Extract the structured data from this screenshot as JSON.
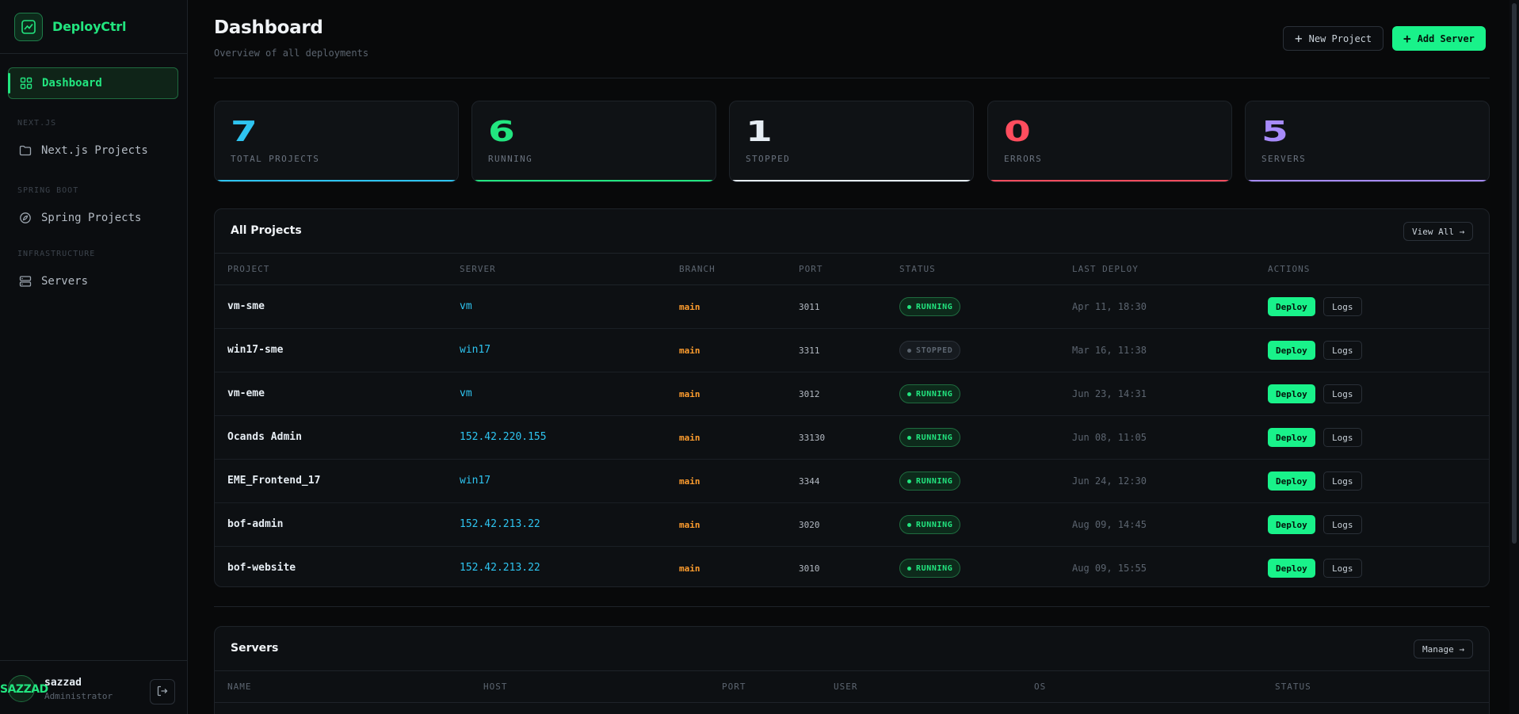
{
  "app": {
    "name": "DeployCtrl"
  },
  "sidebar": {
    "items": [
      {
        "label": "Dashboard",
        "icon": "grid-icon"
      },
      {
        "section": "NEXT.JS",
        "label": "Next.js Projects",
        "icon": "folder-icon"
      },
      {
        "section": "SPRING BOOT",
        "label": "Spring Projects",
        "icon": "spring-icon"
      },
      {
        "section": "INFRASTRUCTURE",
        "label": "Servers",
        "icon": "server-icon"
      }
    ],
    "user": {
      "avatar_text": "SAZZAD",
      "name": "sazzad",
      "role": "Administrator"
    }
  },
  "header": {
    "title": "Dashboard",
    "subtitle": "Overview of all deployments",
    "new_project": "New Project",
    "add_server": "Add Server"
  },
  "stats": [
    {
      "value": "7",
      "label": "TOTAL PROJECTS",
      "color": "#2ec4f0"
    },
    {
      "value": "6",
      "label": "RUNNING",
      "color": "#22e57f"
    },
    {
      "value": "1",
      "label": "STOPPED",
      "color": "#e6edf3"
    },
    {
      "value": "0",
      "label": "ERRORS",
      "color": "#ff4d5e"
    },
    {
      "value": "5",
      "label": "SERVERS",
      "color": "#a78bfa"
    }
  ],
  "projects": {
    "title": "All Projects",
    "view_all": "View All →",
    "columns": [
      "PROJECT",
      "SERVER",
      "BRANCH",
      "PORT",
      "STATUS",
      "LAST DEPLOY",
      "ACTIONS"
    ],
    "deploy_label": "Deploy",
    "logs_label": "Logs",
    "rows": [
      {
        "project": "vm-sme",
        "server": "vm",
        "branch": "main",
        "port": "3011",
        "status": "RUNNING",
        "last_deploy": "Apr 11, 18:30"
      },
      {
        "project": "win17-sme",
        "server": "win17",
        "branch": "main",
        "port": "3311",
        "status": "STOPPED",
        "last_deploy": "Mar 16, 11:38"
      },
      {
        "project": "vm-eme",
        "server": "vm",
        "branch": "main",
        "port": "3012",
        "status": "RUNNING",
        "last_deploy": "Jun 23, 14:31"
      },
      {
        "project": "Ocands Admin",
        "server": "152.42.220.155",
        "branch": "main",
        "port": "33130",
        "status": "RUNNING",
        "last_deploy": "Jun 08, 11:05"
      },
      {
        "project": "EME_Frontend_17",
        "server": "win17",
        "branch": "main",
        "port": "3344",
        "status": "RUNNING",
        "last_deploy": "Jun 24, 12:30"
      },
      {
        "project": "bof-admin",
        "server": "152.42.213.22",
        "branch": "main",
        "port": "3020",
        "status": "RUNNING",
        "last_deploy": "Aug 09, 14:45"
      },
      {
        "project": "bof-website",
        "server": "152.42.213.22",
        "branch": "main",
        "port": "3010",
        "status": "RUNNING",
        "last_deploy": "Aug 09, 15:55"
      }
    ]
  },
  "servers": {
    "title": "Servers",
    "manage": "Manage →",
    "columns": [
      "NAME",
      "HOST",
      "PORT",
      "USER",
      "OS",
      "STATUS"
    ]
  }
}
